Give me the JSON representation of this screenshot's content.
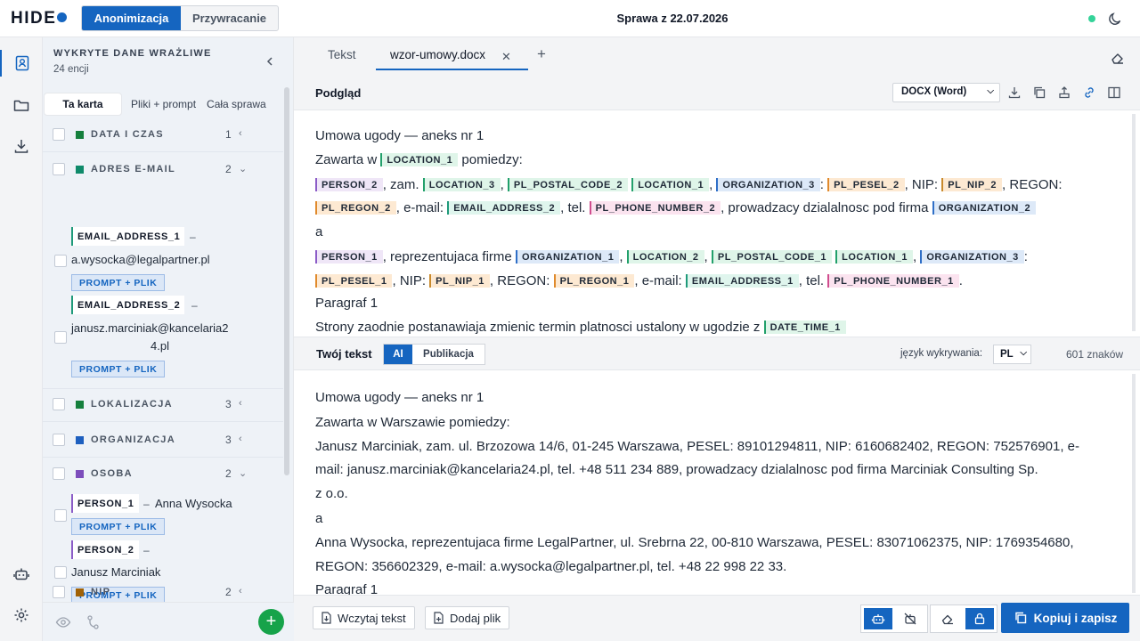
{
  "app": {
    "logo_text": "HIDE",
    "case_title": "Sprawa z 22.07.2026"
  },
  "modes": [
    {
      "label": "Anonimizacja",
      "active": true
    },
    {
      "label": "Przywracanie",
      "active": false
    }
  ],
  "rail": {
    "items": [
      "contacts-icon",
      "folder-icon",
      "download-icon",
      "robot-icon",
      "settings-icon"
    ]
  },
  "panel": {
    "title": "WYKRYTE DANE WRAŻLIWE",
    "count": "24 encji",
    "scope_tabs": [
      "Ta karta",
      "Pliki + prompt",
      "Cała sprawa"
    ],
    "groups": [
      {
        "name": "DATA I CZAS",
        "count": "1",
        "color": "#15803d"
      },
      {
        "name": "ADRES E-MAIL",
        "count": "2",
        "color": "#0f8a6a",
        "entities": [
          {
            "tag": "EMAIL_ADDRESS_1",
            "dash": "–",
            "value": "a.wysocka@legalpartner.pl"
          },
          {
            "tag": "EMAIL_ADDRESS_2",
            "dash": "–",
            "value_l1": "janusz.marciniak@kancelaria2",
            "value_l2": "4.pl"
          }
        ]
      },
      {
        "name": "LOKALIZACJA",
        "count": "3",
        "color": "#15803d"
      },
      {
        "name": "ORGANIZACJA",
        "count": "3",
        "color": "#1d5fbf"
      },
      {
        "name": "OSOBA",
        "count": "2",
        "color": "#7c4dbb",
        "entities": [
          {
            "tag": "PERSON_1",
            "dash": "–",
            "value": "Anna Wysocka"
          },
          {
            "tag": "PERSON_2",
            "dash": "–",
            "value": "Janusz Marciniak"
          }
        ]
      },
      {
        "name": "NIP",
        "count": "2",
        "color": "#a16207"
      }
    ],
    "prompt_button": "PROMPT + PLIK"
  },
  "tabs": [
    {
      "label": "Tekst"
    },
    {
      "label": "wzor-umowy.docx",
      "active": true
    }
  ],
  "preview": {
    "label": "Podgląd",
    "format": "DOCX (Word)",
    "lines": {
      "l1": "Umowa ugody — aneks nr 1",
      "l2a": "Zawarta w",
      "l2b": "pomiedzy:",
      "l3a": ", zam.",
      "l3b": ",",
      "l3c": "",
      "l3d": ",",
      "l3e": ":",
      "l3f": ", NIP:",
      "l3g": ", REGON:",
      "l4a": ", e-mail:",
      "l4b": ", tel.",
      "l4c": ", prowadzacy dzialalnosc pod firma",
      "l5": "a",
      "l6a": ", reprezentujaca firme",
      "l6b": ",",
      "l6c": ",",
      "l6d": "",
      "l6e": ",",
      "l6f": ":",
      "l7a": ", NIP:",
      "l7b": ", REGON:",
      "l7c": ", e-mail:",
      "l7d": ", tel.",
      "l7e": ".",
      "l8": "Paragraf 1",
      "l9": "Strony zaodnie postanawiaja zmienic termin platnosci ustalony w ugodzie z"
    },
    "chips": {
      "location_1": "LOCATION_1",
      "location_2": "LOCATION_2",
      "location_3": "LOCATION_3",
      "person_1": "PERSON_1",
      "person_2": "PERSON_2",
      "org_1": "ORGANIZATION_1",
      "org_2": "ORGANIZATION_2",
      "org_3": "ORGANIZATION_3",
      "postal_1": "PL_POSTAL_CODE_1",
      "postal_2": "PL_POSTAL_CODE_2",
      "pesel_1": "PL_PESEL_1",
      "pesel_2": "PL_PESEL_2",
      "nip_1": "PL_NIP_1",
      "nip_2": "PL_NIP_2",
      "regon_1": "PL_REGON_1",
      "regon_2": "PL_REGON_2",
      "email_1": "EMAIL_ADDRESS_1",
      "email_2": "EMAIL_ADDRESS_2",
      "phone_1": "PL_PHONE_NUMBER_1",
      "phone_2": "PL_PHONE_NUMBER_2",
      "date_1": "DATE_TIME_1"
    }
  },
  "your_text": {
    "label": "Twój tekst",
    "mode_ai": "AI",
    "mode_pub": "Publikacja",
    "lang_label": "język wykrywania:",
    "lang_value": "PL",
    "chars": "601 znaków",
    "lines": [
      "Umowa ugody — aneks nr 1",
      "Zawarta w Warszawie pomiedzy:",
      "Janusz Marciniak, zam. ul. Brzozowa 14/6, 01-245 Warszawa, PESEL: 89101294811, NIP: 6160682402, REGON: 752576901, e-",
      "mail: janusz.marciniak@kancelaria24.pl, tel. +48 511 234 889, prowadzacy dzialalnosc pod firma Marciniak Consulting Sp.",
      "z o.o.",
      "a",
      "Anna Wysocka, reprezentujaca firme LegalPartner, ul. Srebrna 22, 00-810 Warszawa, PESEL: 83071062375, NIP: 1769354680,",
      "REGON: 356602329, e-mail: a.wysocka@legalpartner.pl, tel. +48 22 998 22 33.",
      "Paragraf 1"
    ]
  },
  "footer": {
    "load_text": "Wczytaj tekst",
    "add_file": "Dodaj plik",
    "copy_save": "Kopiuj i zapisz"
  },
  "colors": {
    "accent": "#1565c0",
    "online": "#34d399",
    "add": "#16a34a"
  }
}
